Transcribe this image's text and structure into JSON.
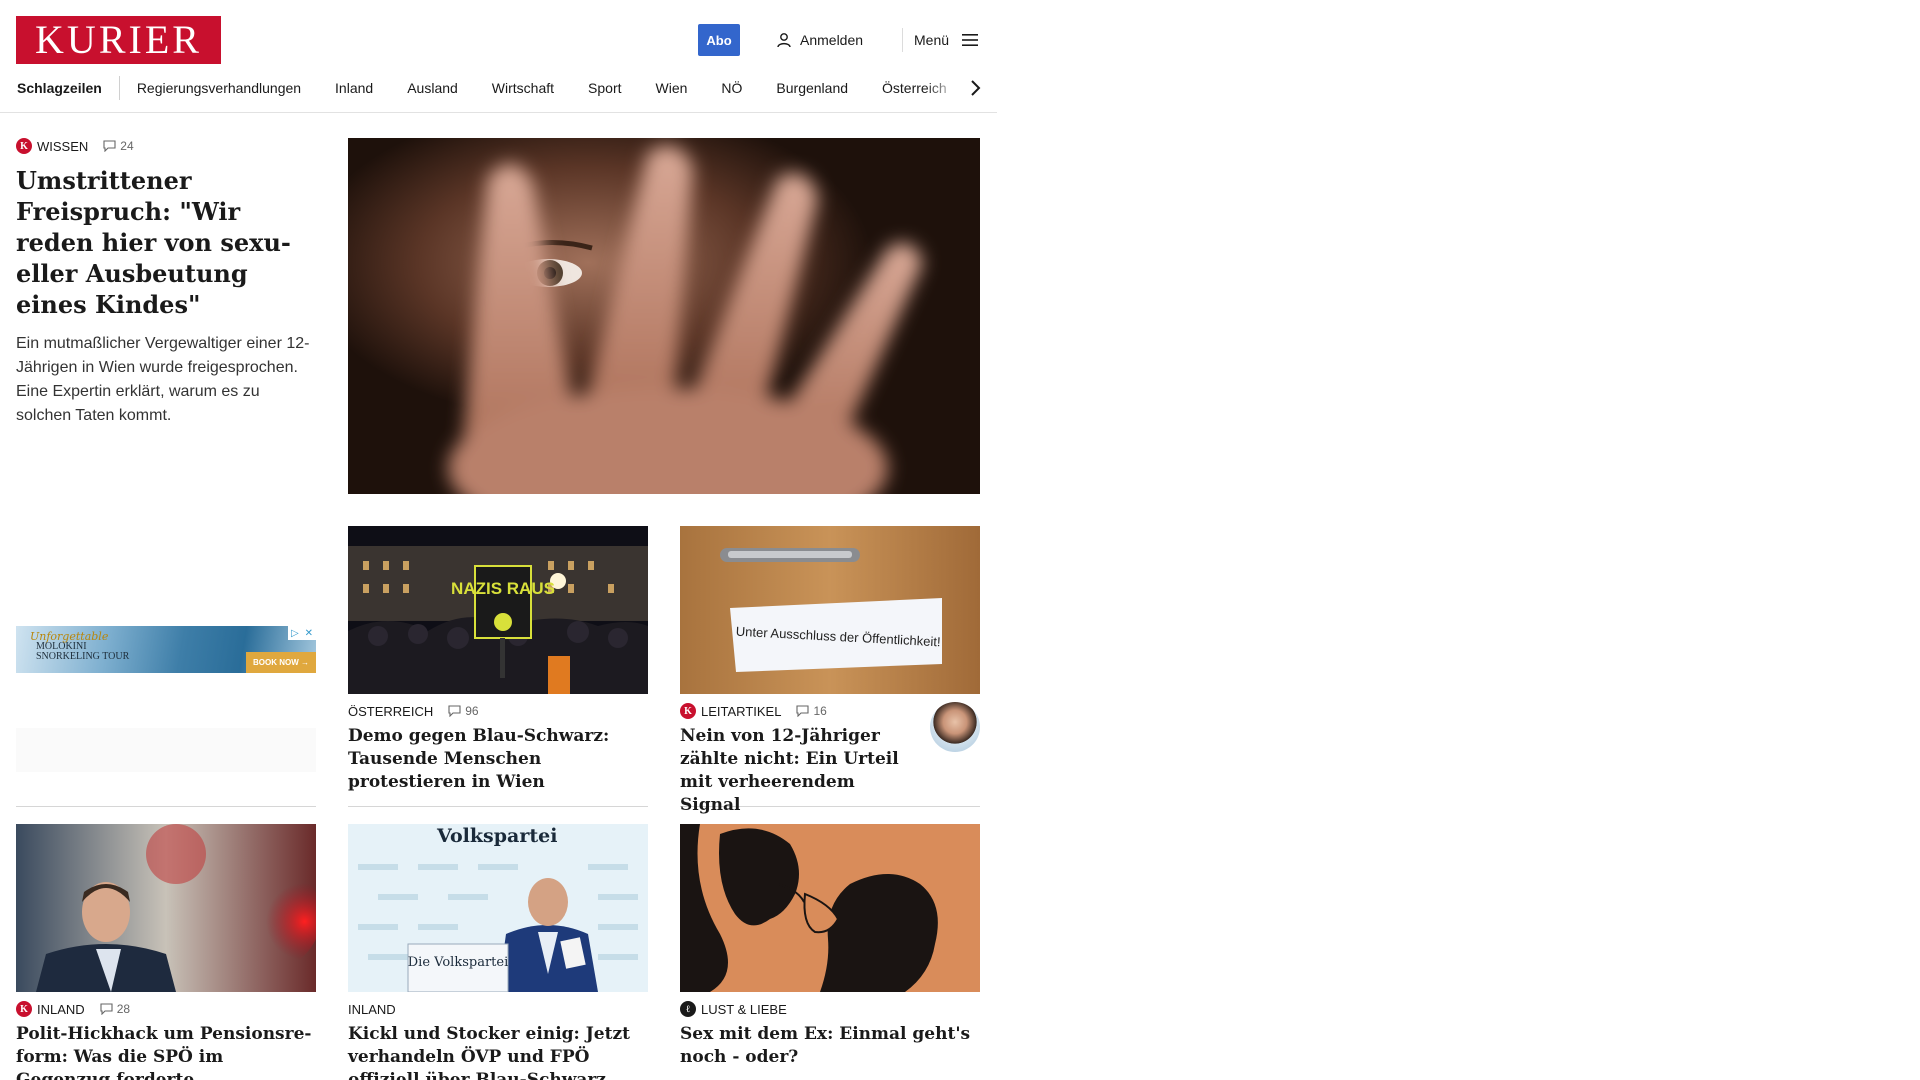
{
  "header": {
    "logo_text": "KURIER",
    "abo_label": "Abo",
    "login_label": "Anmelden",
    "menu_label": "Menü"
  },
  "nav": {
    "items": [
      "Schlagzeilen",
      "Regierungsverhandlungen",
      "Inland",
      "Ausland",
      "Wirtschaft",
      "Sport",
      "Wien",
      "NÖ",
      "Burgenland",
      "Österreich"
    ]
  },
  "lead": {
    "category": "WISSEN",
    "comments": "24",
    "title": "Umstrittener Freispruch: \"Wir reden hier von sexu­eller Ausbeutung eines Kindes\"",
    "teaser": "Ein mutmaßlicher Vergewaltiger einer 12-Jährigen in Wien wurde freigesprochen. Eine Expertin erklärt, warum es zu solchen Taten kommt."
  },
  "ad": {
    "script_text": "Unforgettable",
    "line1": "MOLOKINI",
    "line2": "SNORKELING TOUR",
    "button": "BOOK NOW →"
  },
  "cards": [
    {
      "category": "ÖSTERREICH",
      "comments": "96",
      "title": "Demo gegen Blau-Schwarz: Tau­sende Menschen protestieren in Wien"
    },
    {
      "category": "LEITARTIKEL",
      "comments": "16",
      "title": "Nein von 12-Jähriger zählte nicht: Ein Urteil mit verheerendem Signal",
      "image_text": "Unter Ausschluss der Öffentlichkeit!"
    },
    {
      "category": "INLAND",
      "comments": "28",
      "title": "Polit-Hickhack um Pensionsre­form: Was die SPÖ im Gegenzug forderte"
    },
    {
      "category": "INLAND",
      "title": "Kickl und Stocker einig: Jetzt ver­handeln ÖVP und FPÖ offiziell über Blau-Schwarz",
      "image_text": "Volkspartei",
      "podium_text": "Die Volkspartei"
    },
    {
      "category": "LUST & LIEBE",
      "title": "Sex mit dem Ex: Einmal geht's noch - oder?"
    }
  ],
  "demo_sign": "NAZIS RAUS",
  "colors": {
    "brand": "#c8102e",
    "abo": "#3366cc"
  }
}
